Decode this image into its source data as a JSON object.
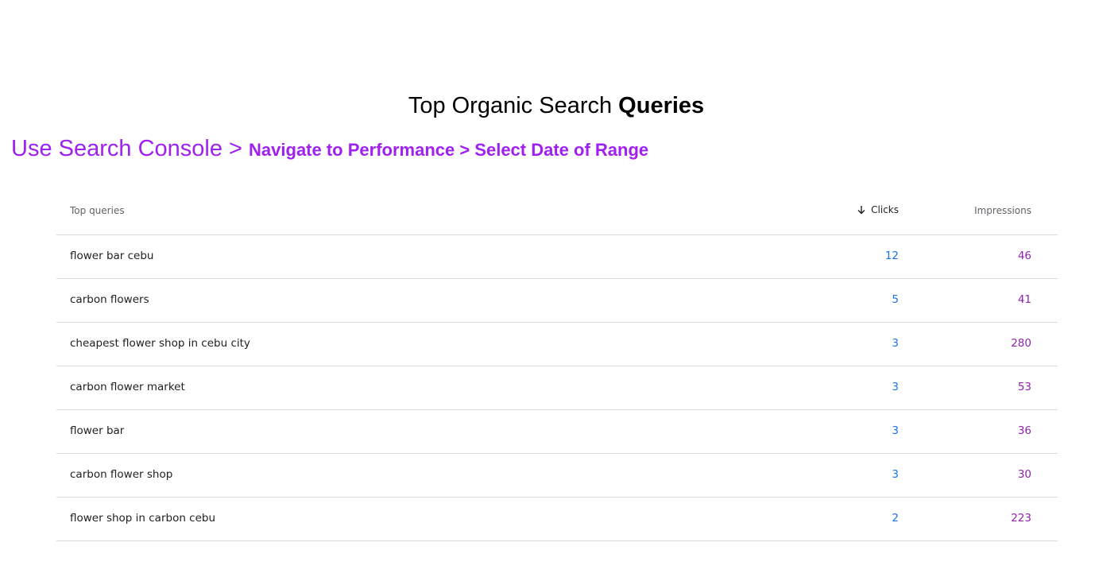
{
  "heading": {
    "title_regular": "Top Organic Search ",
    "title_bold": "Queries"
  },
  "instructions": {
    "part1": "Use Search Console > ",
    "part2": "Navigate to Performance > Select Date of Range"
  },
  "colors": {
    "instruction": "#a020f0",
    "clicks": "#1a73e8",
    "impressions": "#8e24aa"
  },
  "table": {
    "headers": {
      "query": "Top queries",
      "clicks": "Clicks",
      "impressions": "Impressions",
      "sort_icon": "arrow-down-icon"
    },
    "rows": [
      {
        "query": "flower bar cebu",
        "clicks": "12",
        "impressions": "46"
      },
      {
        "query": "carbon flowers",
        "clicks": "5",
        "impressions": "41"
      },
      {
        "query": "cheapest flower shop in cebu city",
        "clicks": "3",
        "impressions": "280"
      },
      {
        "query": "carbon flower market",
        "clicks": "3",
        "impressions": "53"
      },
      {
        "query": "flower bar",
        "clicks": "3",
        "impressions": "36"
      },
      {
        "query": "carbon flower shop",
        "clicks": "3",
        "impressions": "30"
      },
      {
        "query": "flower shop in carbon cebu",
        "clicks": "2",
        "impressions": "223"
      }
    ]
  }
}
